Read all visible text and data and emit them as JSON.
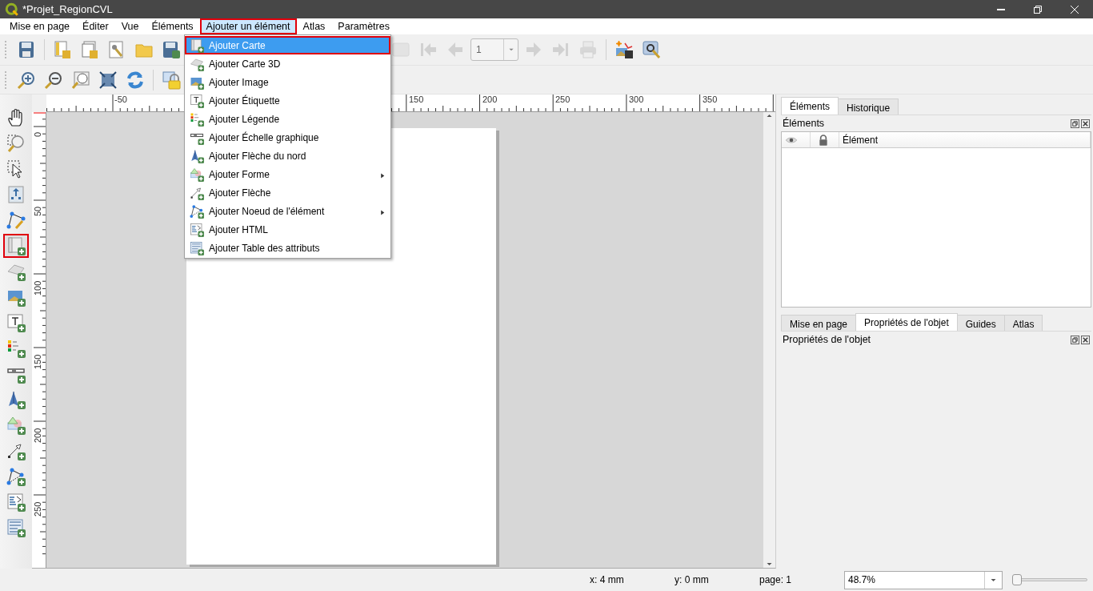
{
  "window": {
    "title": "*Projet_RegionCVL"
  },
  "menubar": [
    {
      "label": "Mise en page",
      "selected": false,
      "highlighted": false
    },
    {
      "label": "Éditer",
      "selected": false,
      "highlighted": false
    },
    {
      "label": "Vue",
      "selected": false,
      "highlighted": false
    },
    {
      "label": "Éléments",
      "selected": false,
      "highlighted": false
    },
    {
      "label": "Ajouter un élément",
      "selected": true,
      "highlighted": true
    },
    {
      "label": "Atlas",
      "selected": false,
      "highlighted": false
    },
    {
      "label": "Paramètres",
      "selected": false,
      "highlighted": false
    }
  ],
  "menu": [
    {
      "label": "Ajouter Carte",
      "selected": true,
      "highlighted": true,
      "submenu": false
    },
    {
      "label": "Ajouter Carte 3D",
      "selected": false,
      "highlighted": false,
      "submenu": false
    },
    {
      "label": "Ajouter Image",
      "selected": false,
      "highlighted": false,
      "submenu": false
    },
    {
      "label": "Ajouter Étiquette",
      "selected": false,
      "highlighted": false,
      "submenu": false
    },
    {
      "label": "Ajouter Légende",
      "selected": false,
      "highlighted": false,
      "submenu": false
    },
    {
      "label": "Ajouter Échelle graphique",
      "selected": false,
      "highlighted": false,
      "submenu": false
    },
    {
      "label": "Ajouter Flèche du nord",
      "selected": false,
      "highlighted": false,
      "submenu": false
    },
    {
      "label": "Ajouter Forme",
      "selected": false,
      "highlighted": false,
      "submenu": true
    },
    {
      "label": "Ajouter Flèche",
      "selected": false,
      "highlighted": false,
      "submenu": false
    },
    {
      "label": "Ajouter Noeud de l'élément",
      "selected": false,
      "highlighted": false,
      "submenu": true
    },
    {
      "label": "Ajouter HTML",
      "selected": false,
      "highlighted": false,
      "submenu": false
    },
    {
      "label": "Ajouter Table des attributs",
      "selected": false,
      "highlighted": false,
      "submenu": false
    }
  ],
  "toolbar_1": [
    {
      "kind": "icon",
      "disabled": false
    },
    {
      "kind": "icon",
      "disabled": false
    },
    {
      "kind": "icon",
      "disabled": false
    },
    {
      "kind": "icon",
      "disabled": false
    },
    {
      "kind": "icon",
      "disabled": false
    },
    {
      "kind": "icon",
      "disabled": false
    },
    {
      "kind": "icon",
      "disabled": true
    },
    {
      "kind": "icon",
      "disabled": true
    },
    {
      "kind": "icon",
      "disabled": true
    },
    {
      "kind": "combo",
      "value": "1",
      "disabled": true
    },
    {
      "kind": "icon",
      "disabled": true
    },
    {
      "kind": "icon",
      "disabled": true
    },
    {
      "kind": "icon",
      "disabled": true
    },
    {
      "kind": "icon",
      "disabled": false
    },
    {
      "kind": "icon",
      "disabled": false
    }
  ],
  "toolbar_2": [
    {
      "kind": "icon",
      "disabled": false
    },
    {
      "kind": "icon",
      "disabled": false
    },
    {
      "kind": "icon",
      "disabled": false
    },
    {
      "kind": "icon",
      "disabled": false
    },
    {
      "kind": "icon",
      "disabled": false
    },
    {
      "kind": "icon",
      "disabled": false
    }
  ],
  "toolbox": [
    {
      "highlighted": false
    },
    {
      "highlighted": false
    },
    {
      "highlighted": false
    },
    {
      "highlighted": false
    },
    {
      "highlighted": false
    },
    {
      "highlighted": true
    },
    {
      "highlighted": false
    },
    {
      "highlighted": false
    },
    {
      "highlighted": false
    },
    {
      "highlighted": false
    },
    {
      "highlighted": false
    },
    {
      "highlighted": false
    },
    {
      "highlighted": false
    },
    {
      "highlighted": false
    },
    {
      "highlighted": false
    },
    {
      "highlighted": false
    },
    {
      "highlighted": false
    }
  ],
  "ruler_horizontal": [
    "-50",
    "150",
    "200",
    "250",
    "300",
    "350"
  ],
  "ruler_vertical": [
    "0",
    "50",
    "100",
    "150",
    "200",
    "250"
  ],
  "items_panel": {
    "tabs": [
      {
        "label": "Éléments",
        "selected": true
      },
      {
        "label": "Historique",
        "selected": false
      }
    ],
    "title": "Éléments",
    "columns": [
      "Élément"
    ]
  },
  "properties_panel": {
    "tabs": [
      {
        "label": "Mise en page",
        "selected": false
      },
      {
        "label": "Propriétés de l'objet",
        "selected": true
      },
      {
        "label": "Guides",
        "selected": false
      },
      {
        "label": "Atlas",
        "selected": false
      }
    ],
    "title": "Propriétés de l'objet"
  },
  "status_bar": {
    "x": "x: 4 mm",
    "y": "y: 0 mm",
    "page": "page: 1",
    "zoom": "48.7%",
    "zoom_slider": {
      "level": 0.02
    }
  }
}
